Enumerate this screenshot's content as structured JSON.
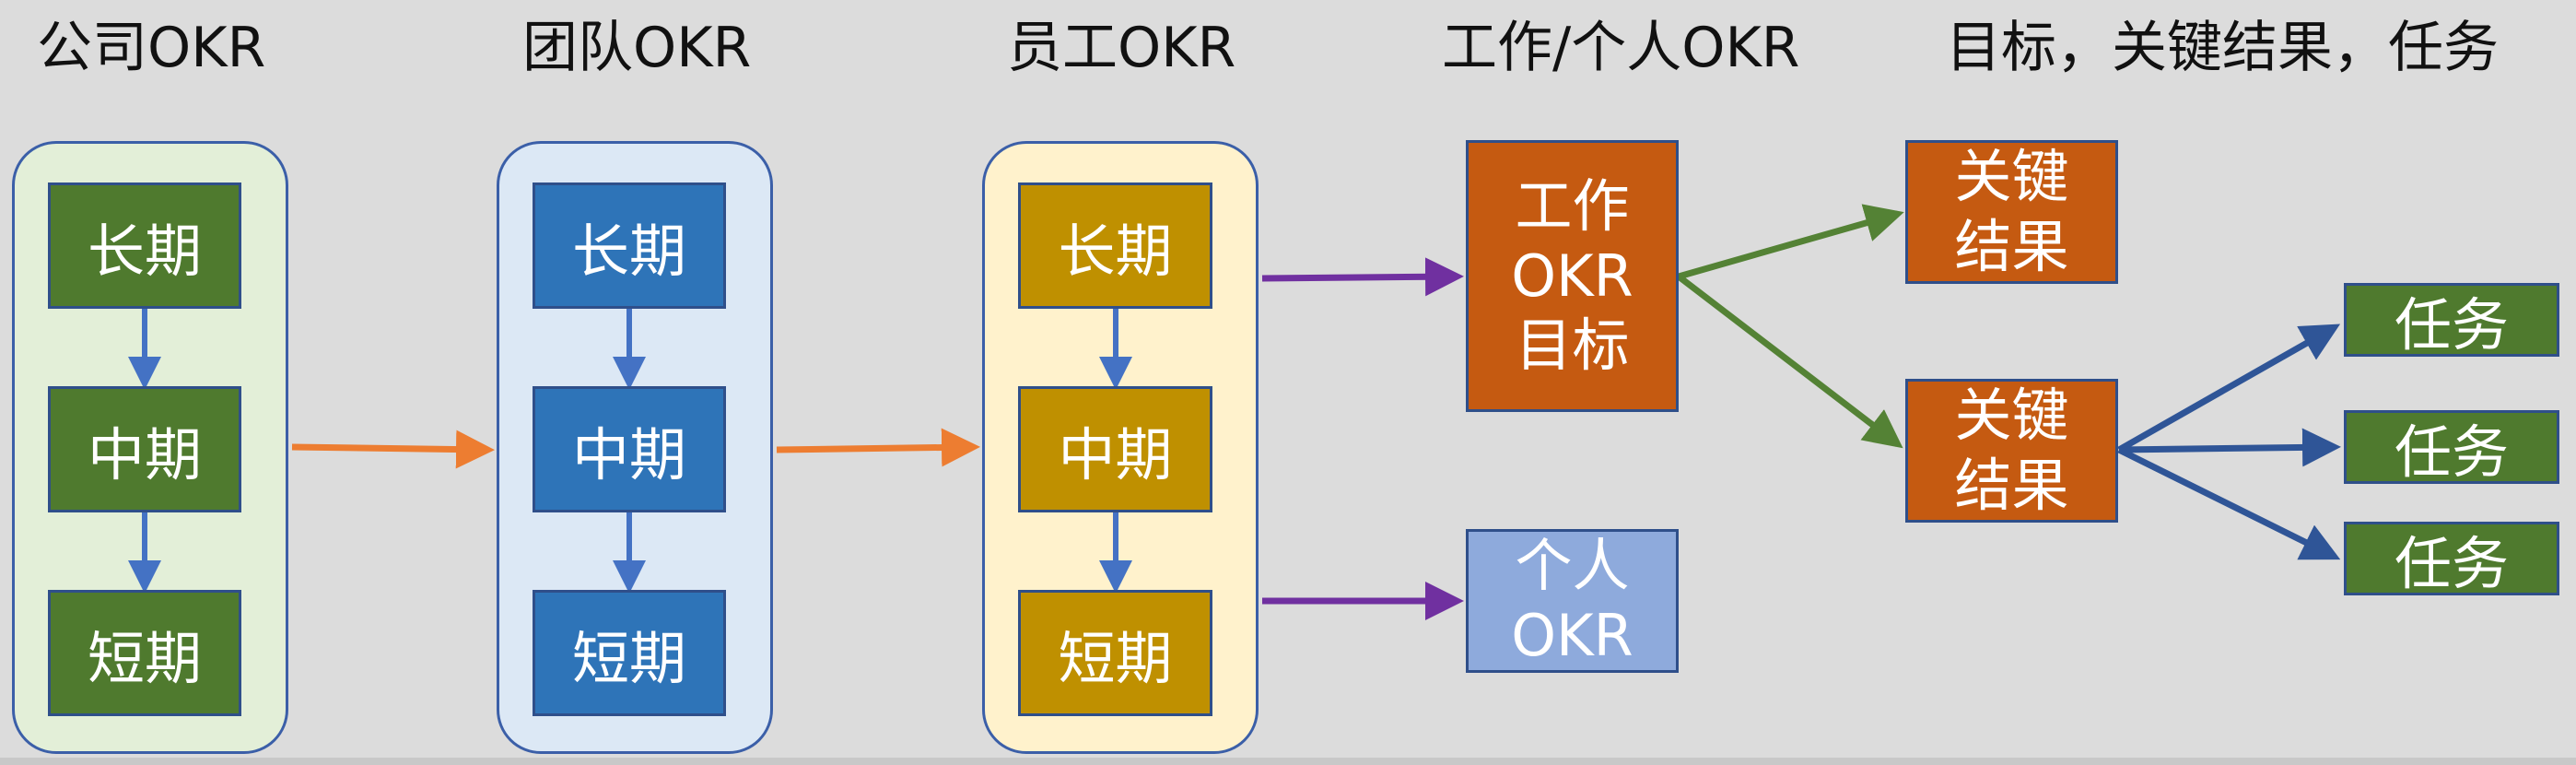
{
  "colors": {
    "background": "#dcdcdc",
    "company_group_bg": "#e3efd8",
    "team_group_bg": "#dce8f5",
    "employee_group_bg": "#fff2cc",
    "company_box": "#4f7a2e",
    "team_box": "#2e74b8",
    "employee_box": "#bf9000",
    "orange_box": "#c55a11",
    "personal_box": "#8eaadc",
    "arrow_blue": "#4472c4",
    "arrow_orange": "#ed7d31",
    "arrow_purple": "#7030a0",
    "arrow_green": "#548235",
    "arrow_navy": "#2f5597"
  },
  "titles": {
    "company": "公司OKR",
    "team": "团队OKR",
    "employee": "员工OKR",
    "work_personal": "工作/个人OKR",
    "goal_kr_task": "目标，关键结果，任务"
  },
  "periods": {
    "long": "长期",
    "mid": "中期",
    "short": "短期"
  },
  "work_okr": {
    "line1": "工作",
    "line2": "OKR",
    "line3": "目标"
  },
  "personal_okr": {
    "line1": "个人",
    "line2": "OKR"
  },
  "key_results": [
    {
      "line1": "关键",
      "line2": "结果"
    },
    {
      "line1": "关键",
      "line2": "结果"
    }
  ],
  "tasks": [
    "任务",
    "任务",
    "任务"
  ]
}
